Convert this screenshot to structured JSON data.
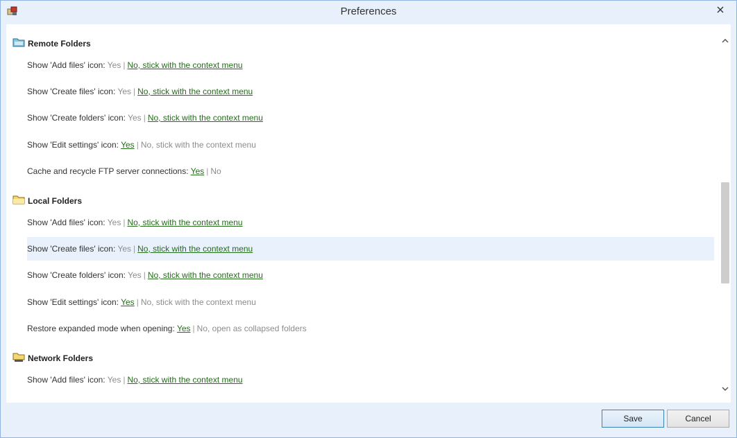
{
  "window": {
    "title": "Preferences"
  },
  "sections": [
    {
      "title": "Remote Folders",
      "icon": "remote-folder-icon",
      "rows": [
        {
          "label": "Show 'Add files' icon:",
          "yes": "Yes",
          "no": "No, stick with the context menu",
          "selected": "no"
        },
        {
          "label": "Show 'Create files' icon:",
          "yes": "Yes",
          "no": "No, stick with the context menu",
          "selected": "no"
        },
        {
          "label": "Show 'Create folders' icon:",
          "yes": "Yes",
          "no": "No, stick with the context menu",
          "selected": "no"
        },
        {
          "label": "Show 'Edit settings' icon:",
          "yes": "Yes",
          "no": "No, stick with the context menu",
          "selected": "yes"
        },
        {
          "label": "Cache and recycle FTP server connections:",
          "yes": "Yes",
          "no": "No",
          "selected": "yes"
        }
      ]
    },
    {
      "title": "Local Folders",
      "icon": "local-folder-icon",
      "rows": [
        {
          "label": "Show 'Add files' icon:",
          "yes": "Yes",
          "no": "No, stick with the context menu",
          "selected": "no"
        },
        {
          "label": "Show 'Create files' icon:",
          "yes": "Yes",
          "no": "No, stick with the context menu",
          "selected": "no"
        },
        {
          "label": "Show 'Create folders' icon:",
          "yes": "Yes",
          "no": "No, stick with the context menu",
          "selected": "no"
        },
        {
          "label": "Show 'Edit settings' icon:",
          "yes": "Yes",
          "no": "No, stick with the context menu",
          "selected": "yes"
        },
        {
          "label": "Restore expanded mode when opening:",
          "yes": "Yes",
          "no": "No, open as collapsed folders",
          "selected": "yes"
        }
      ]
    },
    {
      "title": "Network Folders",
      "icon": "network-folder-icon",
      "rows": [
        {
          "label": "Show 'Add files' icon:",
          "yes": "Yes",
          "no": "No, stick with the context menu",
          "selected": "no"
        }
      ]
    }
  ],
  "footer": {
    "save_label": "Save",
    "cancel_label": "Cancel"
  },
  "colors": {
    "link": "#246b1a",
    "inactive": "#8c8c8c",
    "highlight": "#e8f1fc",
    "accent": "#8fb4e3"
  }
}
